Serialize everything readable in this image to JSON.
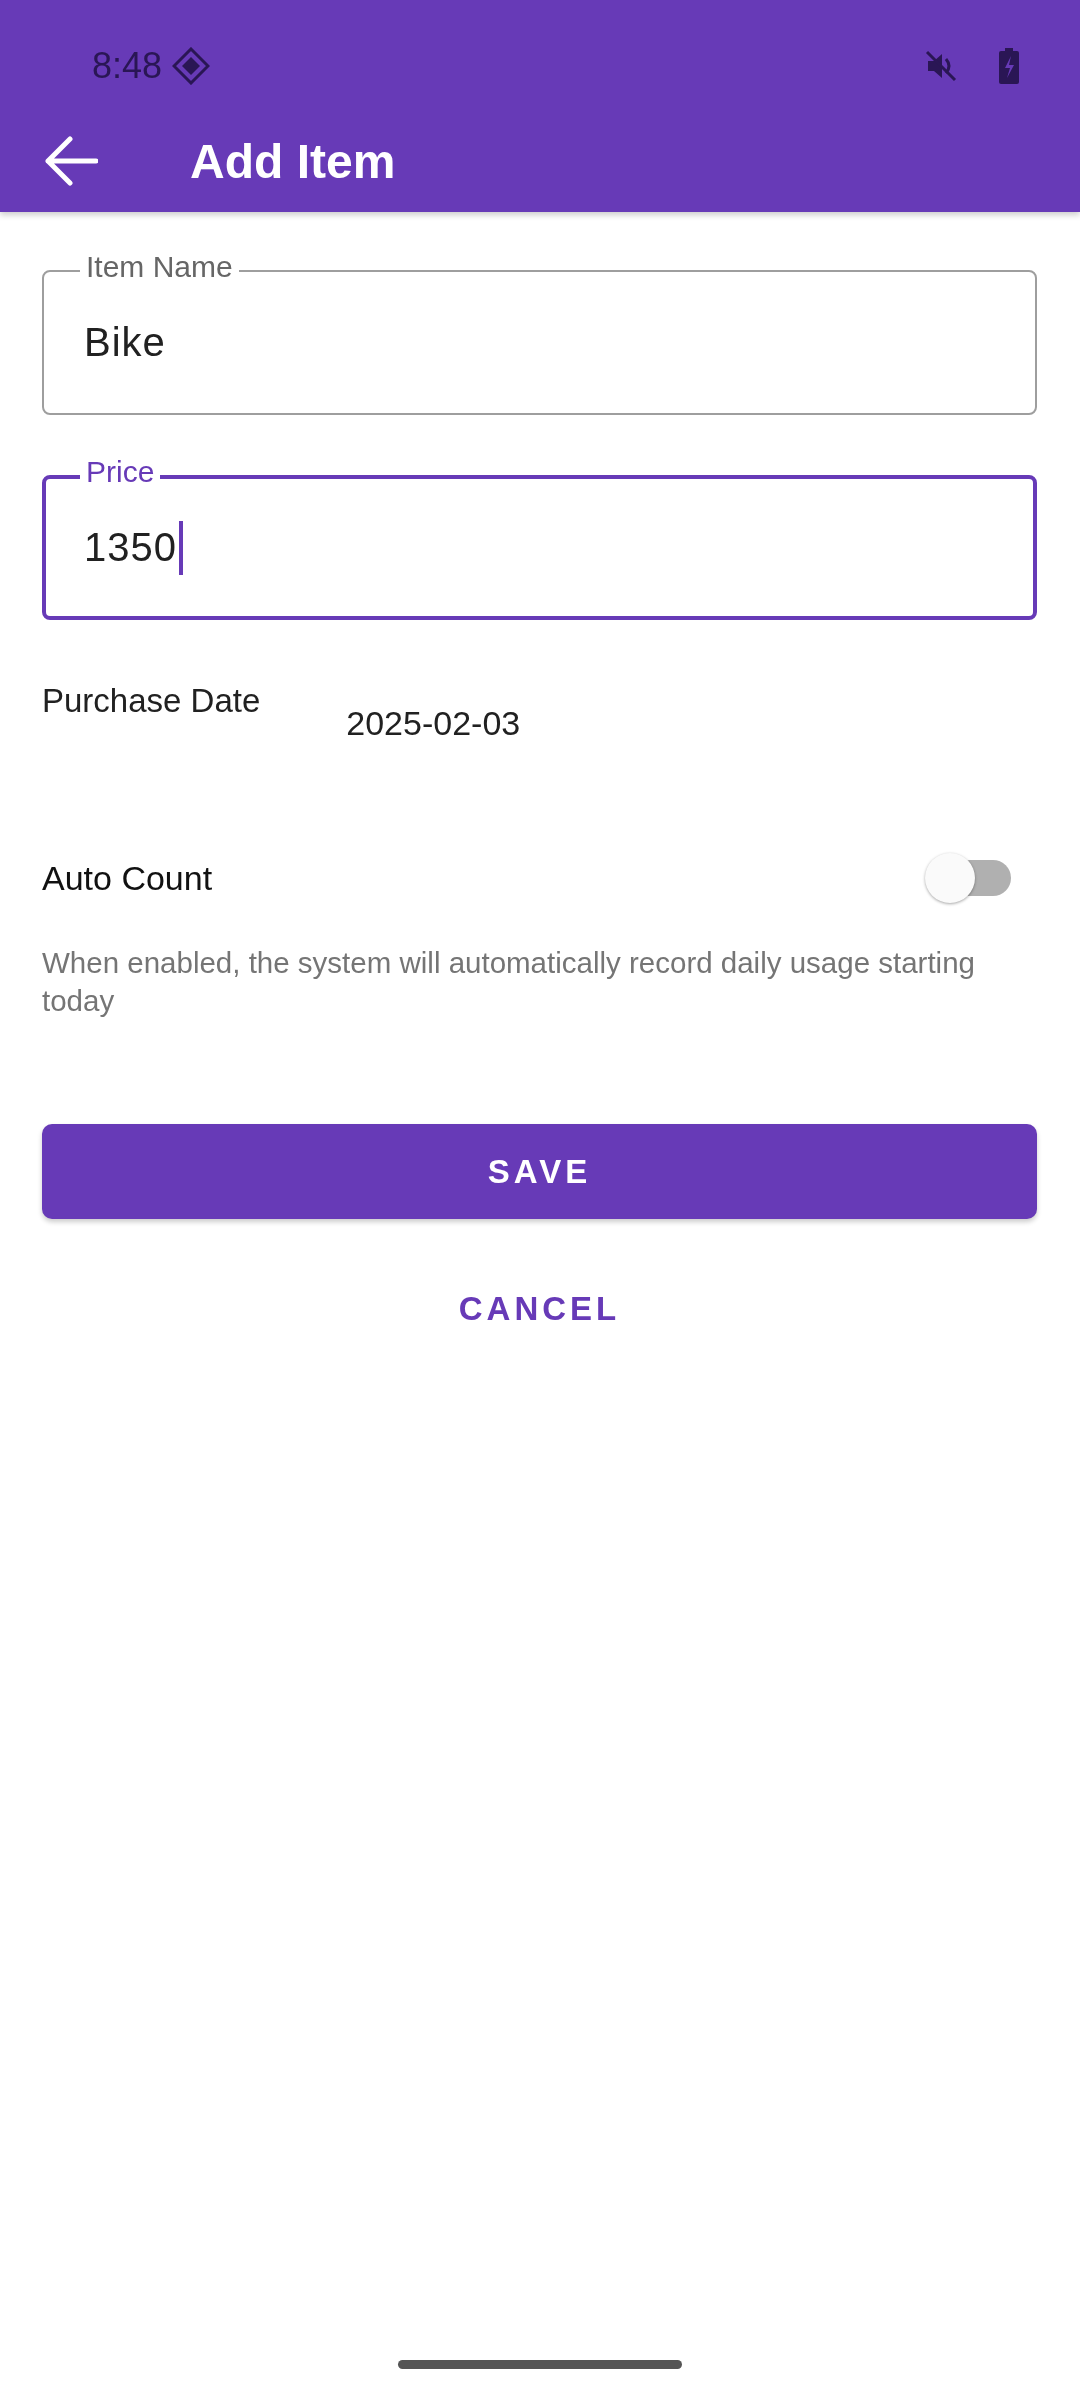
{
  "status_bar": {
    "time": "8:48"
  },
  "app_bar": {
    "title": "Add Item"
  },
  "fields": [
    {
      "label": "Item Name",
      "value": "Bike",
      "focused": false
    },
    {
      "label": "Price",
      "value": "1350",
      "focused": true
    }
  ],
  "purchase_date": {
    "label": "Purchase Date",
    "value": "2025-02-03"
  },
  "auto_count": {
    "label": "Auto Count",
    "on": false,
    "helper": "When enabled, the system will automatically record daily usage starting today"
  },
  "buttons": [
    {
      "label": "SAVE",
      "kind": "filled"
    },
    {
      "label": "CANCEL",
      "kind": "text"
    }
  ]
}
